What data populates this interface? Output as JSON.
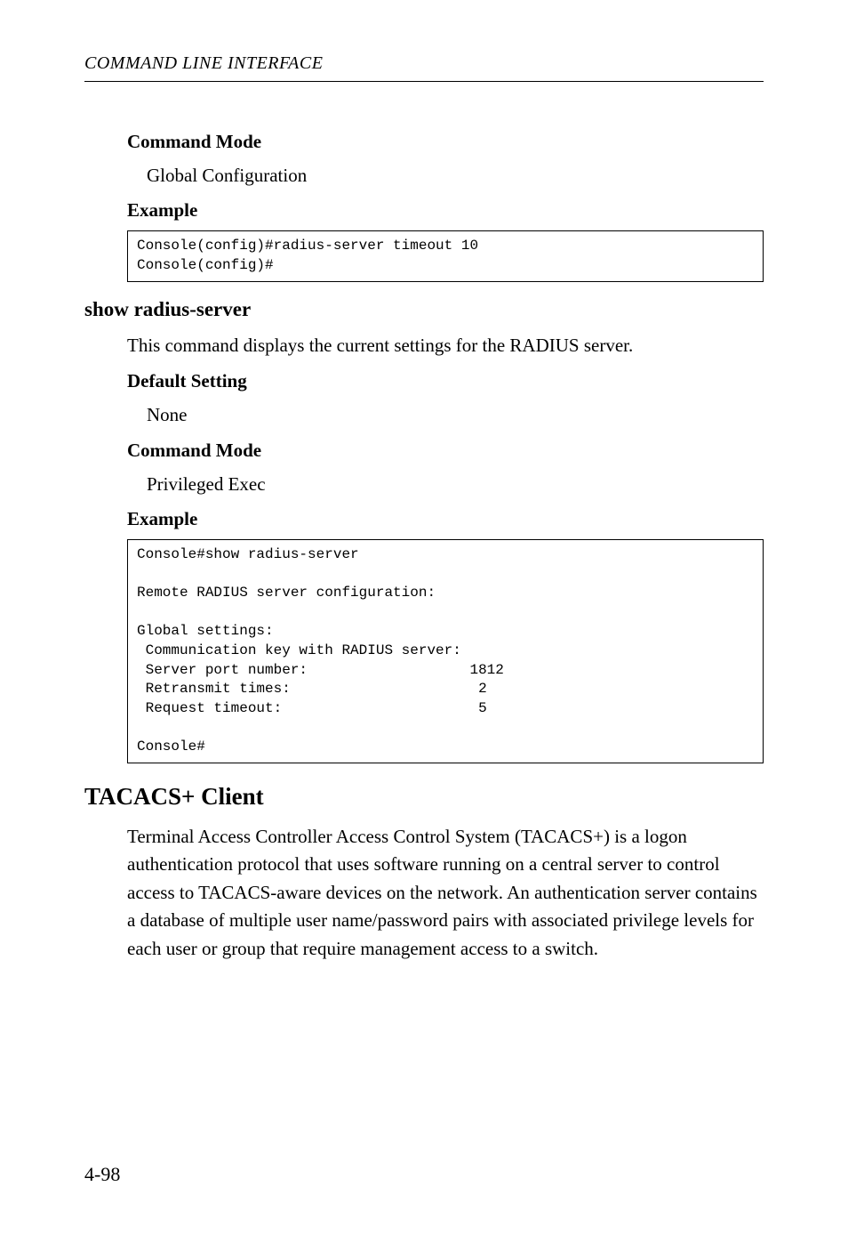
{
  "page": {
    "header": "COMMAND LINE INTERFACE",
    "number": "4-98"
  },
  "sections": {
    "commandMode1": {
      "title": "Command Mode",
      "body": "Global Configuration"
    },
    "example1": {
      "title": "Example",
      "code": "Console(config)#radius-server timeout 10\nConsole(config)#"
    },
    "showRadius": {
      "title": "show radius-server",
      "body": "This command displays the current settings for the RADIUS server."
    },
    "defaultSetting": {
      "title": "Default Setting",
      "body": "None"
    },
    "commandMode2": {
      "title": "Command Mode",
      "body": "Privileged Exec"
    },
    "example2": {
      "title": "Example",
      "code": "Console#show radius-server\n\nRemote RADIUS server configuration:\n\nGlobal settings:\n Communication key with RADIUS server:\n Server port number:                   1812\n Retransmit times:                      2\n Request timeout:                       5\n\nConsole#"
    },
    "tacacs": {
      "title": "TACACS+ Client",
      "body": "Terminal Access Controller Access Control System (TACACS+) is a logon authentication protocol that uses software running on a central server to control access to TACACS-aware devices on the network. An authentication server contains a database of multiple user name/password pairs with associated privilege levels for each user or group that require management access to a switch."
    }
  }
}
